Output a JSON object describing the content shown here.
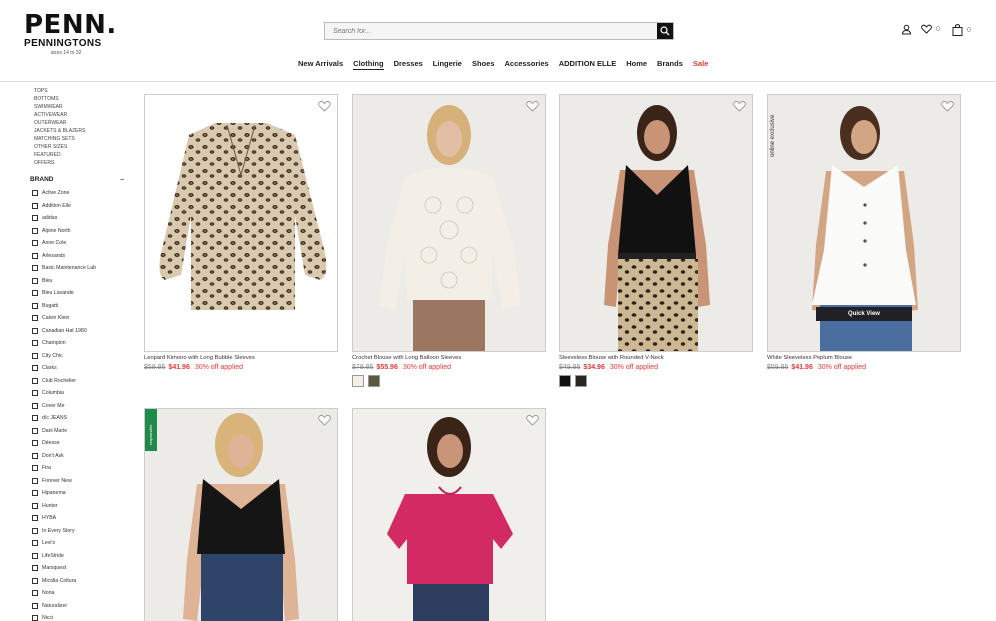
{
  "brand": {
    "logo": "PENN.",
    "sub": "PENNINGTONS",
    "tagline": "sizes 14 to 32"
  },
  "search": {
    "placeholder": "Search for..."
  },
  "utility": {
    "wishlist_count": "0",
    "cart_count": "0"
  },
  "nav": [
    {
      "label": "New Arrivals"
    },
    {
      "label": "Clothing",
      "active": true
    },
    {
      "label": "Dresses"
    },
    {
      "label": "Lingerie"
    },
    {
      "label": "Shoes"
    },
    {
      "label": "Accessories"
    },
    {
      "label": "ADDITION ELLE"
    },
    {
      "label": "Home"
    },
    {
      "label": "Brands"
    },
    {
      "label": "Sale",
      "sale": true
    }
  ],
  "sidebar": {
    "categories": [
      "TOPS",
      "BOTTOMS",
      "SWIMWEAR",
      "ACTIVEWEAR",
      "OUTERWEAR",
      "JACKETS & BLAZERS",
      "MATCHING SETS",
      "OTHER SIZES",
      "FEATURED",
      "OFFERS"
    ],
    "brand_heading": "BRAND",
    "brand_toggle": "–",
    "brands": [
      "Active Zone",
      "Addition Elle",
      "adidas",
      "Alpine North",
      "Anne Cole",
      "Arlesands",
      "Basic Maintenance Lab",
      "Bleu",
      "Bleu Lavande",
      "Bugatti",
      "Calvin Klein",
      "Canadian Hat 1980",
      "Champion",
      "City Chic",
      "Clarks",
      "Club Rochelier",
      "Columbia",
      "Cover Me",
      "d/c JEANS",
      "Dani Marie",
      "Déesse",
      "Don't Ask",
      "Fira",
      "Forever New",
      "Hipanema",
      "Hunter",
      "HYBA",
      "In Every Story",
      "Levi's",
      "LifeStride",
      "Marsquest",
      "Micolla Coltura",
      "Nona",
      "Naturalizer",
      "Nicci"
    ]
  },
  "products": [
    {
      "name": "Leopard Kimono with Long Bubble Sleeves",
      "old_price": "$59.95",
      "new_price": "$41.96",
      "off": "30% off applied",
      "swatches": []
    },
    {
      "name": "Crochet Blouse with Long Balloon Sleeves",
      "old_price": "$79.95",
      "new_price": "$55.96",
      "off": "30% off applied",
      "swatches": [
        "#f3efe3",
        "#5a5a3c"
      ]
    },
    {
      "name": "Sleeveless Blouse with Rounded V-Neck",
      "old_price": "$49.95",
      "new_price": "$34.96",
      "off": "30% off applied",
      "swatches": [
        "#111111",
        "#2a2622"
      ]
    },
    {
      "name": "White Sleeveless Peplum Blouse",
      "old_price": "$59.95",
      "new_price": "$41.96",
      "off": "30% off applied",
      "swatches": [],
      "badge": "online exclusive",
      "quick_view": "Quick View"
    },
    {
      "name": "",
      "badge_green": "responsible"
    },
    {
      "name": ""
    }
  ],
  "colors": {
    "sale": "#e3383c",
    "accent_green": "#1e8b4c"
  }
}
